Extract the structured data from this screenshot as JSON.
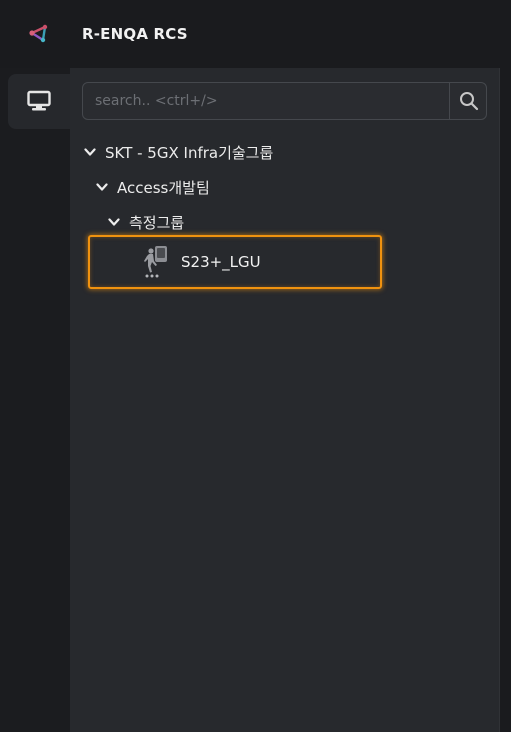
{
  "app": {
    "title": "R-ENQA RCS",
    "logo_icon": "share-node-icon",
    "accent_color": "#f0920f"
  },
  "sidebar": {
    "items": [
      {
        "name": "monitor-icon",
        "active": true
      }
    ]
  },
  "search": {
    "placeholder": "search.. <ctrl+/>",
    "value": "",
    "button_icon": "search-icon"
  },
  "tree": {
    "nodes": [
      {
        "label": "SKT - 5GX Infra기술그룹",
        "level": 0,
        "expanded": true
      },
      {
        "label": "Access개발팀",
        "level": 1,
        "expanded": true
      },
      {
        "label": "측정그룹",
        "level": 2,
        "expanded": true
      }
    ],
    "device": {
      "label": "S23+_LGU",
      "icon": "walking-device-icon",
      "selected": true
    }
  }
}
